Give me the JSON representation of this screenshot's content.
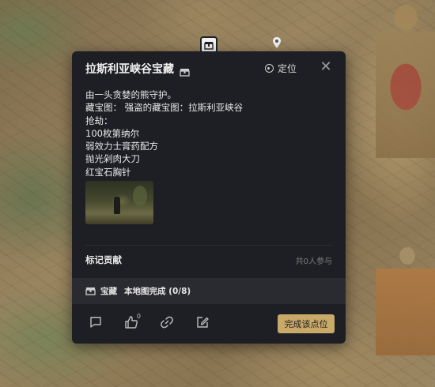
{
  "map": {
    "marker_icon": "chest-marker-icon",
    "pin_icon": "location-pin-icon"
  },
  "popup": {
    "title": "拉斯利亚峡谷宝藏",
    "title_icon": "treasure-chest-icon",
    "locate_label": "定位",
    "close_icon": "close-icon",
    "description_lines": [
      "由一头贪婪的熊守护。",
      "藏宝图：  强盗的藏宝图：拉斯利亚峡谷",
      "抢劫：",
      "100枚第纳尔",
      "弱效力士膏药配方",
      "抛光剁肉大刀",
      "红宝石胸针"
    ],
    "contribution": {
      "title": "标记贡献",
      "participants": "共0人参与"
    },
    "completion": {
      "category": "宝藏",
      "progress_text": "本地图完成 (0/8)"
    },
    "actions": {
      "comment_icon": "comment-icon",
      "like_icon": "thumbs-up-icon",
      "like_count": "0",
      "link_icon": "link-icon",
      "edit_icon": "edit-icon"
    },
    "complete_button": "完成该点位"
  },
  "colors": {
    "popup_bg": "#1e1f24",
    "accent_button": "#c9a968"
  }
}
